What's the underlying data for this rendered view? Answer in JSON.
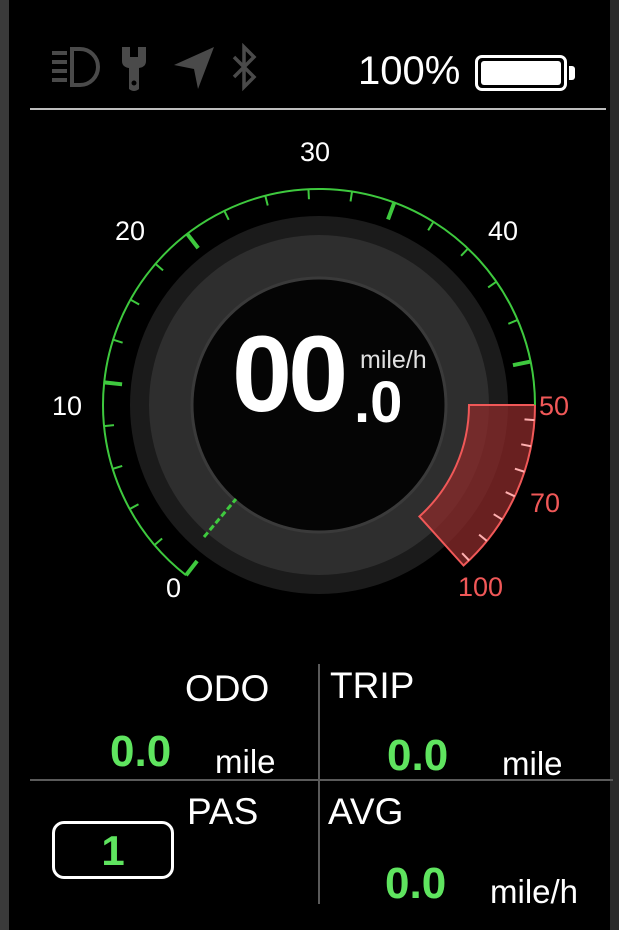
{
  "status": {
    "icons": [
      "headlight-icon",
      "wrench-icon",
      "navigation-icon",
      "bluetooth-icon"
    ],
    "battery_percent": "100%",
    "battery_level": 1.0
  },
  "speedometer": {
    "speed_integer": "00",
    "speed_decimal": ".0",
    "unit": "mile/h",
    "ticks": {
      "t0": "0",
      "t10": "10",
      "t20": "20",
      "t30": "30",
      "t40": "40",
      "t50": "50",
      "t70": "70",
      "t100": "100"
    },
    "colors": {
      "normal": "#3ec93e",
      "danger": "#f05858"
    }
  },
  "stats": {
    "odo": {
      "label": "ODO",
      "value": "0.0",
      "unit": "mile"
    },
    "trip": {
      "label": "TRIP",
      "value": "0.0",
      "unit": "mile"
    },
    "pas": {
      "label": "PAS",
      "value": "1"
    },
    "avg": {
      "label": "AVG",
      "value": "0.0",
      "unit": "mile/h"
    }
  }
}
